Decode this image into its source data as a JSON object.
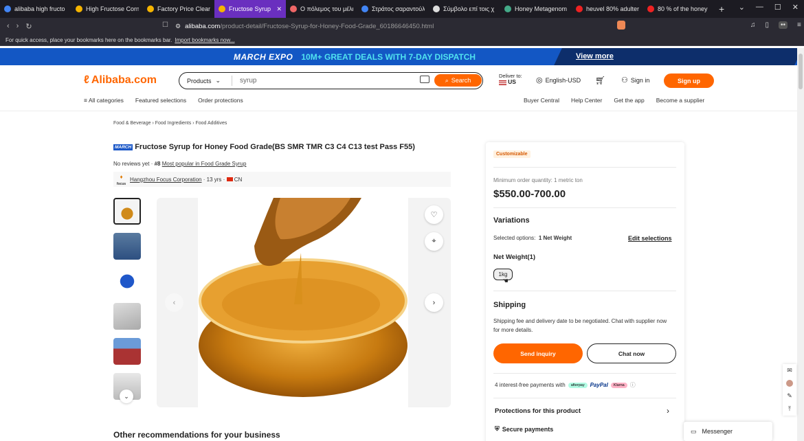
{
  "browser": {
    "tabs": [
      {
        "title": "alibaba high fructo",
        "fav_color": "#4285f4",
        "active": false
      },
      {
        "title": "High Fructose Corn",
        "fav_color": "#f5b400",
        "active": false
      },
      {
        "title": "Factory Price Clear",
        "fav_color": "#f5b400",
        "active": false
      },
      {
        "title": "Fructose Syrup",
        "fav_color": "#f5b400",
        "active": true
      },
      {
        "title": "Ο πόλεμος του μέλι",
        "fav_color": "#e66",
        "active": false
      },
      {
        "title": "Στράτος σαραντούλ",
        "fav_color": "#4285f4",
        "active": false
      },
      {
        "title": "Σύμβολο επί τοις χ",
        "fav_color": "#ddd",
        "active": false
      },
      {
        "title": "Honey Metagenom",
        "fav_color": "#4a8",
        "active": false
      },
      {
        "title": "heuvel 80% adulter",
        "fav_color": "#e22",
        "active": false
      },
      {
        "title": "80 % of the honey",
        "fav_color": "#e22",
        "active": false
      }
    ],
    "new_tab": "+",
    "url_host": "alibaba.com",
    "url_path": "/product-detail/Fructose-Syrup-for-Honey-Food-Grade_60186646450.html",
    "bookmarks_msg": "For quick access, place your bookmarks here on the bookmarks bar.",
    "bookmarks_link": "Import bookmarks now..."
  },
  "banner": {
    "expo": "MARCH EXPO",
    "deals": "10M+ GREAT DEALS WITH 7-DAY DISPATCH",
    "view_more": "View more"
  },
  "header": {
    "logo": "Alibaba.com",
    "search_category": "Products",
    "search_query": "syrup",
    "search_button": "Search",
    "deliver_to": "Deliver to:",
    "deliver_country": "US",
    "language": "English-USD",
    "sign_in": "Sign in",
    "sign_up": "Sign up",
    "nav_left": [
      "All categories",
      "Featured selections",
      "Order protections"
    ],
    "nav_right": [
      "Buyer Central",
      "Help Center",
      "Get the app",
      "Become a supplier"
    ]
  },
  "product": {
    "breadcrumbs": [
      "Food & Beverage",
      "Food Ingredients",
      "Food Additives"
    ],
    "tag": "MARCH",
    "title": "Fructose Syrup for Honey Food Grade(BS SMR TMR C3 C4 C13 test Pass F55)",
    "reviews": "No reviews yet",
    "rank": "#8",
    "rank_label": "Most popular in Food Grade Syrup",
    "supplier_logo": "focus",
    "supplier": "Hangzhou Focus Corporation",
    "supplier_years": "13 yrs",
    "supplier_country": "CN",
    "other_heading": "Other recommendations for your business"
  },
  "panel": {
    "badge": "Customizable",
    "moq": "Minimum order quantity: 1 metric ton",
    "price": "$550.00-700.00",
    "variations_heading": "Variations",
    "selected_label": "Selected options:",
    "selected_value": "1 Net Weight",
    "edit_label": "Edit selections",
    "net_weight_heading": "Net Weight(1)",
    "net_weight_option": "1kg",
    "shipping_heading": "Shipping",
    "shipping_text": "Shipping fee and delivery date to be negotiated. Chat with supplier now for more details.",
    "inquiry_button": "Send inquiry",
    "chat_button": "Chat now",
    "payments_text": "4 interest-free payments with",
    "pay_afterpay": "afterpay",
    "pay_paypal": "PayPal",
    "pay_klarna": "Klarna",
    "protections": "Protections for this product",
    "secure": "Secure payments"
  },
  "messenger": "Messenger"
}
